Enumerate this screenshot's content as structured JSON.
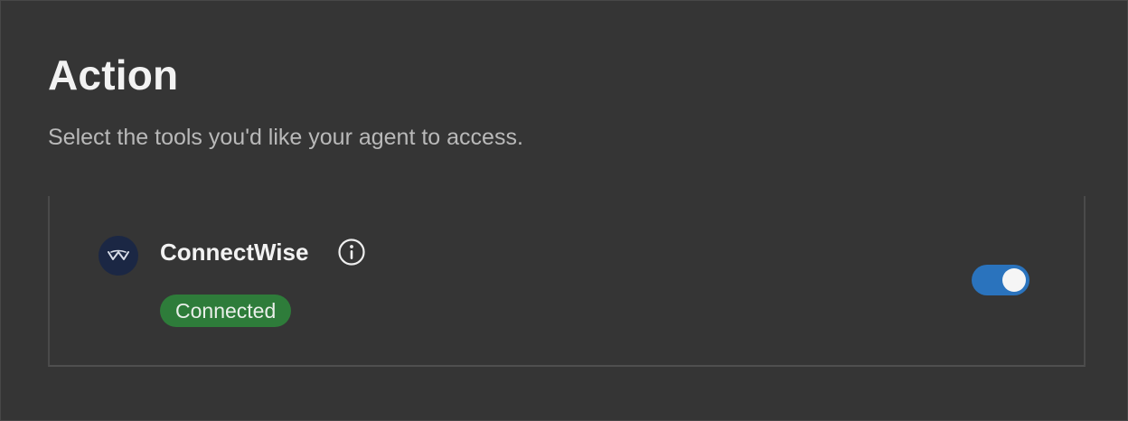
{
  "header": {
    "title": "Action",
    "subtitle": "Select the tools you'd like your agent to access."
  },
  "tools": [
    {
      "name": "ConnectWise",
      "logo_icon": "connectwise-logo-icon",
      "info_icon": "info-icon",
      "status": "Connected",
      "status_color": "#2e7c3a",
      "enabled": true,
      "toggle_color": "#2a73bd"
    }
  ]
}
